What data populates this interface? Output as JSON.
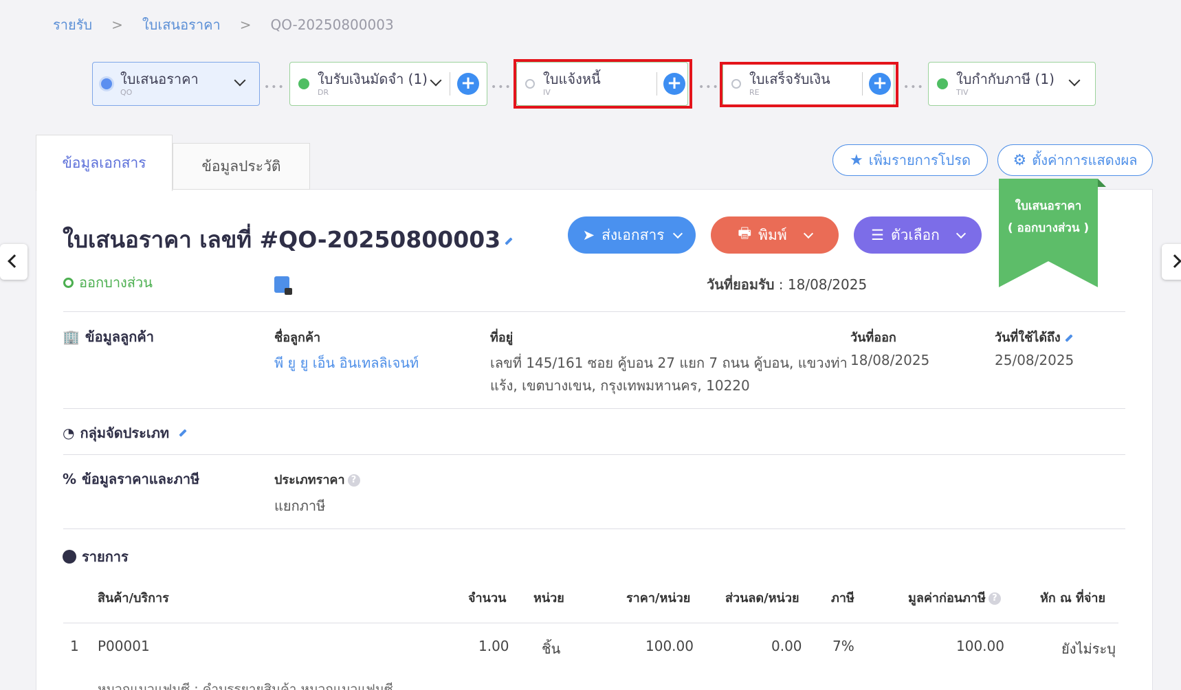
{
  "breadcrumb": {
    "items": [
      "รายรับ",
      "ใบเสนอราคา",
      "QO-20250800003"
    ]
  },
  "flow": [
    {
      "label": "ใบเสนอราคา",
      "code": "QO"
    },
    {
      "label": "ใบรับเงินมัดจำ (1)",
      "code": "DR"
    },
    {
      "label": "ใบแจ้งหนี้",
      "code": "IV"
    },
    {
      "label": "ใบเสร็จรับเงิน",
      "code": "RE"
    },
    {
      "label": "ใบกำกับภาษี (1)",
      "code": "TIV"
    }
  ],
  "tabs": [
    "ข้อมูลเอกสาร",
    "ข้อมูลประวัติ"
  ],
  "toolbar": {
    "favorite": "เพิ่มรายการโปรด",
    "display_settings": "ตั้งค่าการแสดงผล"
  },
  "ribbon": {
    "line1": "ใบเสนอราคา",
    "line2": "( ออกบางส่วน )"
  },
  "document": {
    "title": "ใบเสนอราคา เลขที่ #QO-20250800003",
    "status": "ออกบางส่วน",
    "accept_date_label": "วันที่ยอมรับ",
    "accept_date": " : 18/08/2025"
  },
  "actions": {
    "send": "ส่งเอกสาร",
    "print": "พิมพ์",
    "options": "ตัวเลือก"
  },
  "customer": {
    "section": "ข้อมูลลูกค้า",
    "name_label": "ชื่อลูกค้า",
    "name": "พี ยู ยู เอ็น อินเทลลิเจนท์",
    "address_label": "ที่อยู่",
    "address_line1": "เลขที่ 145/161 ซอย คู้บอน 27 แยก 7 ถนน คู้บอน, แขวงท่า",
    "address_line2": "แร้ง, เขตบางเขน, กรุงเทพมหานคร, 10220",
    "issue_label": "วันที่ออก",
    "issue_date": "18/08/2025",
    "valid_label": "วันที่ใช้ได้ถึง",
    "valid_date": "25/08/2025"
  },
  "category": {
    "section": "กลุ่มจัดประเภท"
  },
  "pricing": {
    "section": "ข้อมูลราคาและภาษี",
    "type_label": "ประเภทราคา",
    "type_value": "แยกภาษี"
  },
  "items": {
    "section": "รายการ",
    "headers": [
      "สินค้า/บริการ",
      "จำนวน",
      "หน่วย",
      "ราคา/หน่วย",
      "ส่วนลด/หน่วย",
      "ภาษี",
      "มูลค่าก่อนภาษี",
      "หัก ณ ที่จ่าย"
    ],
    "rows": [
      {
        "no": "1",
        "code": "P00001",
        "qty": "1.00",
        "unit": "ชิ้น",
        "price": "100.00",
        "discount": "0.00",
        "vat": "7%",
        "amount": "100.00",
        "wht": "ยังไม่ระบุ",
        "desc": "หมวกแมวแฟนซี : คำบรรยายสินค้า หมวกแมวแฟนซี"
      }
    ]
  },
  "colors": {
    "primary": "#3d8ef2",
    "print": "#ea6c56",
    "options": "#7c6de8",
    "success": "#4caf50",
    "highlight": "#e4141b"
  }
}
